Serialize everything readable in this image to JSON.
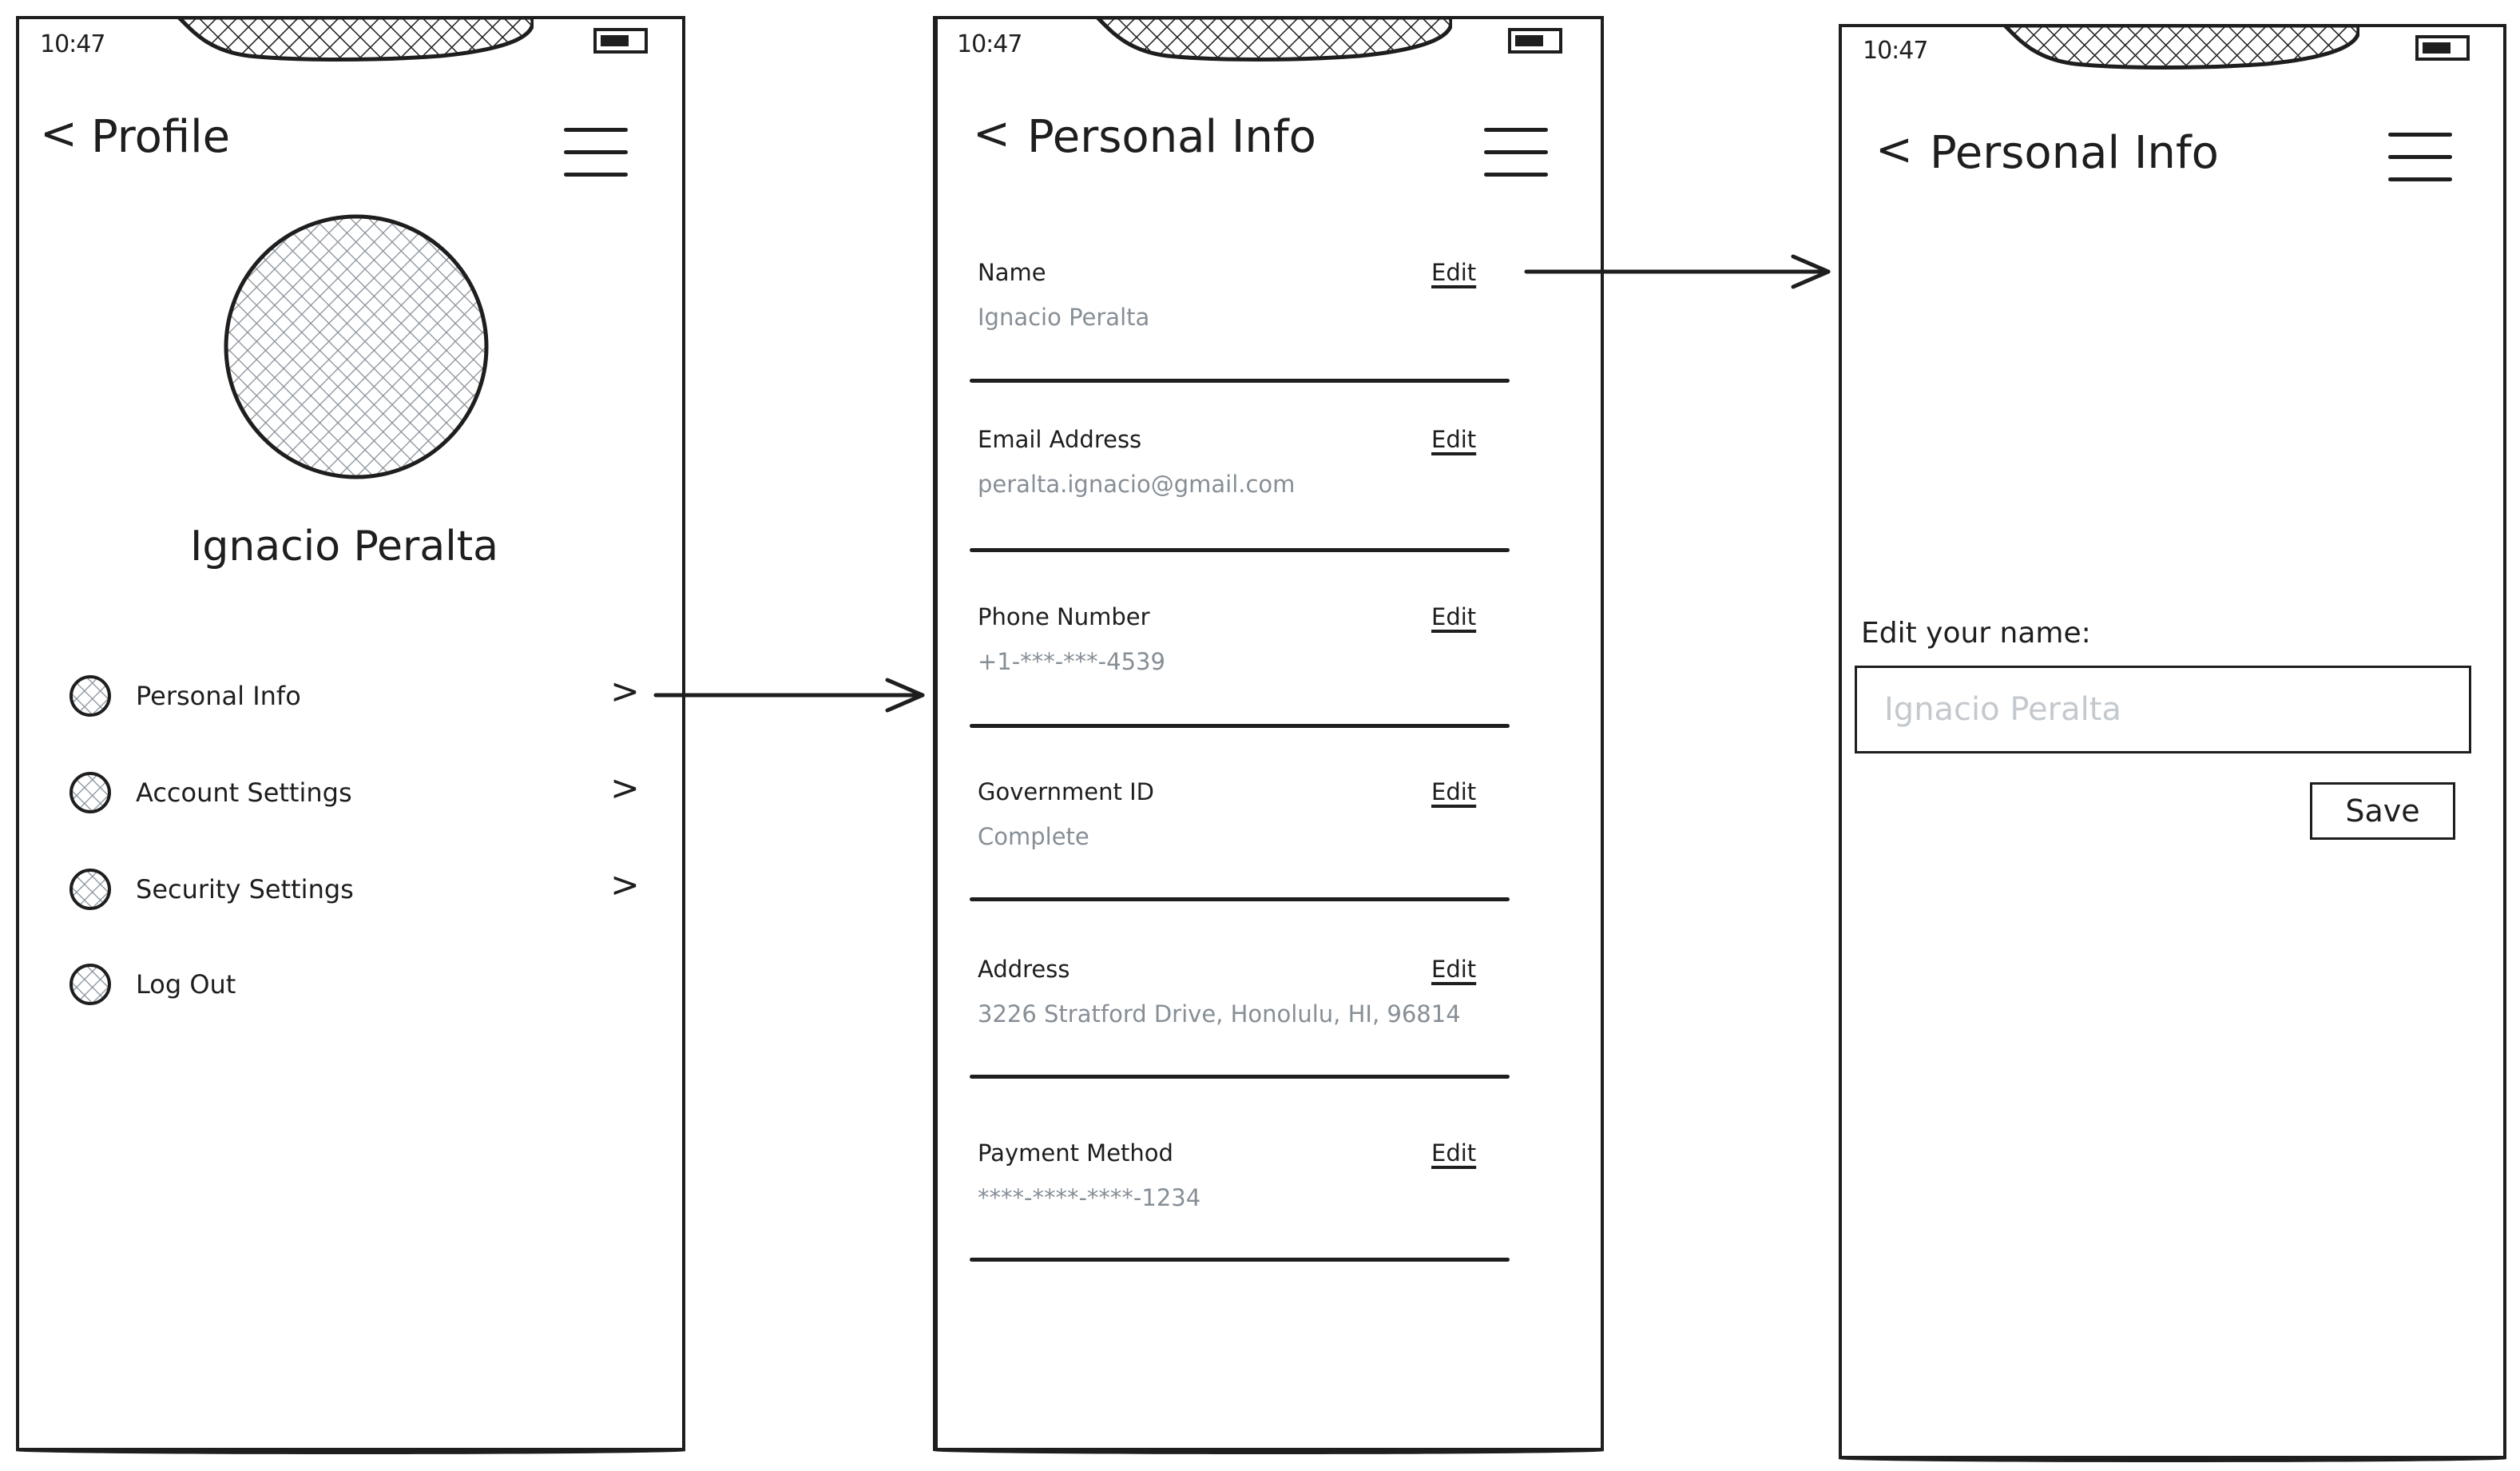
{
  "status_bar": {
    "time": "10:47",
    "battery_level": 0.7
  },
  "screens": {
    "profile": {
      "title": "Profile",
      "user_name": "Ignacio Peralta",
      "menu_items": [
        {
          "label": "Personal Info",
          "icon": "hatched-circle-icon",
          "has_chevron": true
        },
        {
          "label": "Account Settings",
          "icon": "hatched-circle-icon",
          "has_chevron": true
        },
        {
          "label": "Security Settings",
          "icon": "hatched-circle-icon",
          "has_chevron": true
        },
        {
          "label": "Log Out",
          "icon": "hatched-circle-icon",
          "has_chevron": false
        }
      ],
      "chevron_glyph": ">"
    },
    "personal_info": {
      "title": "Personal Info",
      "edit_label": "Edit",
      "fields": [
        {
          "label": "Name",
          "value": "Ignacio Peralta"
        },
        {
          "label": "Email Address",
          "value": "peralta.ignacio@gmail.com"
        },
        {
          "label": "Phone Number",
          "value": "+1-***-***-4539"
        },
        {
          "label": "Government ID",
          "value": "Complete"
        },
        {
          "label": "Address",
          "value": "3226 Stratford Drive, Honolulu, HI, 96814"
        },
        {
          "label": "Payment Method",
          "value": "****-****-****-1234"
        }
      ]
    },
    "edit_name": {
      "title": "Personal Info",
      "field_label": "Edit your name:",
      "input_placeholder": "Ignacio Peralta",
      "input_value": "",
      "save_label": "Save"
    }
  },
  "icons": {
    "back": "<",
    "menu": "hamburger-icon",
    "battery": "battery-icon"
  },
  "colors": {
    "stroke": "#1e1e1e",
    "value_text": "#868e96",
    "placeholder_text": "#c3c9ce",
    "hatch": "#868e96"
  },
  "flows": [
    {
      "from": "profile.menu_items.0",
      "to": "personal_info"
    },
    {
      "from": "personal_info.fields.0.edit",
      "to": "edit_name"
    }
  ]
}
